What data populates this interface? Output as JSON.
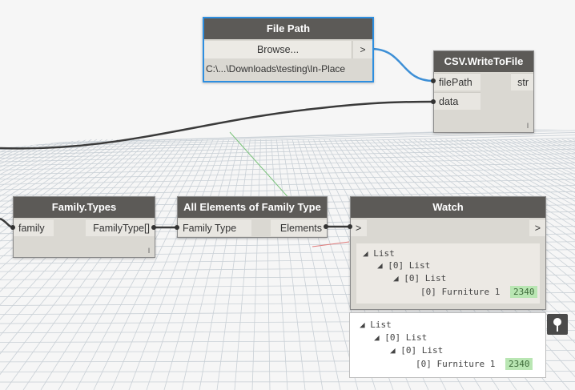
{
  "file_path_node": {
    "title": "File Path",
    "browse_label": "Browse...",
    "output_arrow": ">",
    "path_value": "C:\\...\\Downloads\\testing\\In-Place"
  },
  "csv_node": {
    "title": "CSV.WriteToFile",
    "input_filepath": "filePath",
    "input_data": "data",
    "output_str": "str",
    "lacing": "l"
  },
  "family_types_node": {
    "title": "Family.Types",
    "input_family": "family",
    "output_familytype": "FamilyType[]",
    "lacing": "l"
  },
  "all_elements_node": {
    "title": "All Elements of Family Type",
    "input_family_type": "Family Type",
    "output_elements": "Elements"
  },
  "watch_node": {
    "title": "Watch",
    "input_arrow": ">",
    "output_arrow": ">",
    "tree": {
      "root": "List",
      "level1": "[0] List",
      "level2": "[0] List",
      "item_label": "[0] Furniture 1",
      "item_value": "2340"
    }
  },
  "preview_bubble": {
    "tree": {
      "root": "List",
      "level1": "[0] List",
      "level2": "[0] List",
      "item_label": "[0] Furniture 1",
      "item_value": "2340"
    },
    "pin_icon": "pin-icon"
  },
  "colors": {
    "node_header": "#5c5a57",
    "node_body": "#dad8d2",
    "selected_outline": "#2d8ee0",
    "wire_blue": "#3d8fd6",
    "wire_dark": "#333333",
    "value_badge": "#b9e6b3"
  }
}
